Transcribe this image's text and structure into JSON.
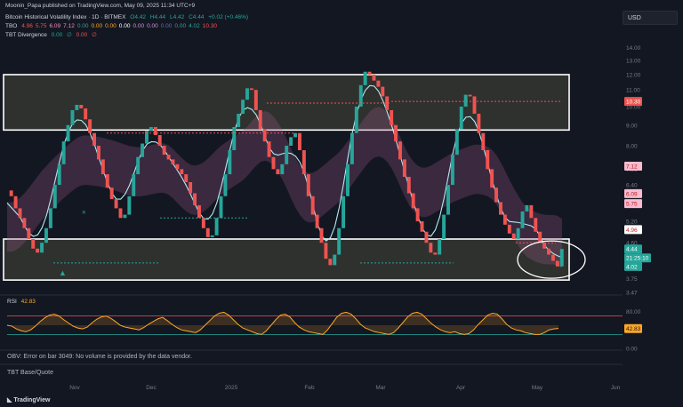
{
  "header": {
    "published": "Moonin_Papa published on TradingView.com, May 09, 2025 11:34 UTC+9",
    "symbol_line": {
      "name": "Bitcoin Historical Volatility Index · 1D · BITMEX",
      "o": "O4.42",
      "h": "H4.44",
      "l": "L4.42",
      "c": "C4.44",
      "chg": "+0.02 (+0.46%)"
    },
    "tbo_line": {
      "label": "TBO",
      "values": [
        {
          "v": "4.96",
          "color": "#ef5350"
        },
        {
          "v": "5.75",
          "color": "#ef5350"
        },
        {
          "v": "6.09",
          "color": "#f48fb1"
        },
        {
          "v": "7.12",
          "color": "#f48fb1"
        },
        {
          "v": "0.00",
          "color": "#26a69a"
        },
        {
          "v": "0.00",
          "color": "#ffa726"
        },
        {
          "v": "0.00",
          "color": "#ffa726"
        },
        {
          "v": "0.00",
          "color": "#ffffff"
        },
        {
          "v": "0.00",
          "color": "#ce93d8"
        },
        {
          "v": "0.00",
          "color": "#ce93d8"
        },
        {
          "v": "0.00",
          "color": "#5c6bc0"
        },
        {
          "v": "0.00",
          "color": "#26a69a"
        },
        {
          "v": "4.02",
          "color": "#26a69a"
        },
        {
          "v": "10.30",
          "color": "#ef5350"
        }
      ]
    },
    "tbt_line": {
      "label": "TBT Divergence",
      "v1": "0.00",
      "sym1": "∅",
      "v2": "0.00",
      "sym2": "∅"
    }
  },
  "currency": "USD",
  "price_axis": {
    "ticks": [
      "14.00",
      "13.00",
      "12.00",
      "11.00",
      "10.00",
      "9.00",
      "8.00",
      "7.00",
      "6.40",
      "5.80",
      "5.20",
      "4.60",
      "4.00",
      "3.75",
      "3.47"
    ],
    "badges": [
      {
        "v": "10.30",
        "bg": "#ef5350",
        "fg": "#ffffff"
      },
      {
        "v": "7.12",
        "bg": "#f8bbd0",
        "fg": "#b71c1c"
      },
      {
        "v": "6.09",
        "bg": "#f8bbd0",
        "fg": "#b71c1c"
      },
      {
        "v": "5.75",
        "bg": "#f8bbd0",
        "fg": "#b71c1c"
      },
      {
        "v": "4.96",
        "bg": "#ffffff",
        "fg": "#c62828"
      },
      {
        "v": "4.44",
        "bg": "#26a69a",
        "fg": "#ffffff"
      },
      {
        "v": "21:25:10",
        "bg": "#26a69a",
        "fg": "#ffffff"
      },
      {
        "v": "4.02",
        "bg": "#26a69a",
        "fg": "#ffffff"
      }
    ]
  },
  "rsi": {
    "label": "RSI",
    "value": "42.83",
    "ticks": [
      "80.00",
      "0.00"
    ],
    "badge": "42.83"
  },
  "obv": {
    "text": "OBV: Error on bar 3049: No volume is provided by the data vendor."
  },
  "tbt_base": {
    "text": "TBT Base/Quote"
  },
  "time_axis": {
    "labels": [
      "Nov",
      "Dec",
      "2025",
      "Feb",
      "Mar",
      "Apr",
      "May",
      "Jun"
    ]
  },
  "brand": {
    "logo": "TradingView"
  },
  "chart_data": {
    "type": "line",
    "title": "Bitcoin Historical Volatility Index · 1D · BITMEX",
    "x_range": [
      "2024-10-07",
      "2025-06-06"
    ],
    "ylim": [
      3.45,
      14.4
    ],
    "ylog": true,
    "grid": false,
    "series": [
      {
        "values": [
          6.2,
          6.0,
          5.6,
          5.3,
          5.0,
          4.7,
          4.45,
          4.35,
          4.6,
          5.0,
          5.6,
          6.4,
          7.2,
          8.2,
          9.0,
          9.8,
          10.1,
          9.9,
          9.3,
          8.6,
          8.0,
          7.4,
          6.8,
          6.3,
          5.9,
          5.6,
          5.3,
          5.4,
          6.0,
          6.8,
          7.5,
          8.1,
          8.7,
          8.9,
          8.5,
          8.0,
          7.6,
          7.4,
          7.2,
          7.0,
          6.8,
          6.5,
          6.1,
          5.7,
          5.3,
          5.0,
          4.75,
          4.8,
          5.3,
          6.0,
          6.8,
          7.8,
          8.9,
          9.6,
          10.4,
          11.1,
          11.0,
          9.8,
          8.8,
          8.2,
          7.5,
          7.0,
          6.8,
          7.2,
          8.0,
          8.4,
          8.6,
          7.8,
          6.8,
          6.0,
          5.4,
          5.0,
          4.6,
          4.2,
          4.05,
          4.3,
          5.0,
          6.0,
          7.2,
          8.6,
          10.0,
          11.3,
          12.2,
          12.0,
          11.6,
          11.2,
          10.6,
          9.8,
          9.0,
          8.2,
          7.4,
          6.7,
          6.1,
          5.6,
          5.2,
          4.9,
          4.6,
          4.35,
          4.3,
          4.7,
          5.4,
          6.4,
          7.6,
          8.8,
          10.0,
          10.7,
          10.6,
          9.6,
          8.6,
          7.8,
          7.0,
          6.3,
          5.8,
          5.4,
          5.1,
          4.85,
          4.7,
          5.0,
          5.5,
          5.7,
          5.3,
          4.9,
          4.6,
          4.45,
          4.3,
          4.15,
          4.02,
          4.44
        ],
        "color": "#ef5350"
      }
    ],
    "annotations": [
      {
        "text": "×",
        "price": 5.4
      },
      {
        "text": "▲",
        "price": 4.1
      }
    ],
    "rsi_series": [
      50,
      48,
      42,
      38,
      36,
      40,
      48,
      58,
      66,
      72,
      74,
      70,
      62,
      55,
      48,
      44,
      42,
      46,
      55,
      63,
      68,
      70,
      65,
      58,
      50,
      46,
      44,
      42,
      40,
      45,
      52,
      58,
      64,
      67,
      60,
      52,
      45,
      40,
      38,
      36,
      34,
      40,
      50,
      60,
      70,
      76,
      78,
      72,
      62,
      52,
      44,
      40,
      36,
      32,
      30,
      38,
      50,
      62,
      72,
      74,
      68,
      56,
      46,
      40,
      36,
      34,
      32,
      30,
      40,
      54,
      68,
      76,
      78,
      74,
      64,
      52,
      44,
      40,
      36,
      34,
      32,
      30,
      34,
      44,
      56,
      68,
      76,
      78,
      74,
      64,
      54,
      46,
      40,
      36,
      34,
      36,
      32,
      30,
      32,
      40,
      52,
      62,
      72,
      76,
      74,
      64,
      52,
      44,
      40,
      38,
      34,
      32,
      30,
      30,
      34,
      40,
      42,
      43
    ],
    "rsi_ylim": [
      0,
      100
    ],
    "rsi_levels": [
      70,
      30
    ]
  }
}
